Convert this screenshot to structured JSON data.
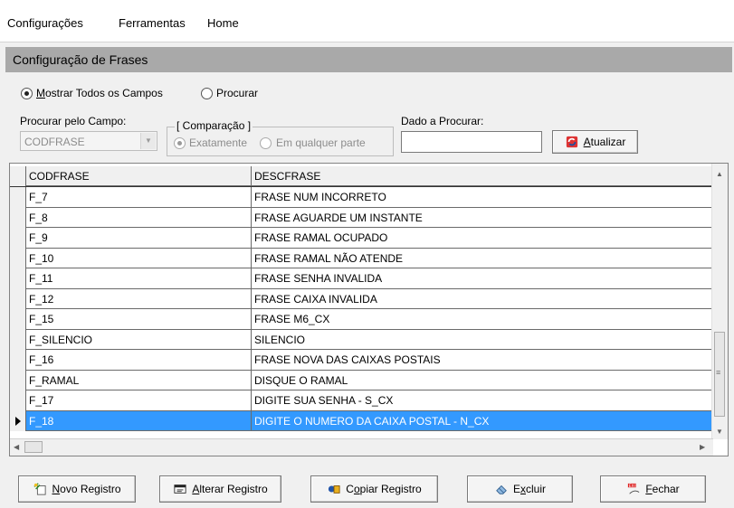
{
  "menu": {
    "items": [
      "Configurações",
      "Ferramentas",
      "Home"
    ]
  },
  "form_title": "Configuração de Frases",
  "mode": {
    "show_all_label": "Mostrar Todos os Campos",
    "show_all_mnemonic": "M",
    "search_label": "Procurar",
    "selected": "show_all"
  },
  "search_field": {
    "label": "Procurar pelo Campo:",
    "value": "CODFRASE"
  },
  "comparison": {
    "legend": "[ Comparação ]",
    "exact_label": "Exatamente",
    "any_label": "Em qualquer parte",
    "selected": "exact"
  },
  "search_value": {
    "label": "Dado a Procurar:",
    "value": ""
  },
  "refresh_button": {
    "label": "Atualizar",
    "mnemonic": "A"
  },
  "grid": {
    "columns": [
      "CODFRASE",
      "DESCFRASE"
    ],
    "rows": [
      [
        "F_7",
        "FRASE NUM INCORRETO"
      ],
      [
        "F_8",
        "FRASE AGUARDE UM INSTANTE"
      ],
      [
        "F_9",
        "FRASE RAMAL OCUPADO"
      ],
      [
        "F_10",
        "FRASE RAMAL NÃO ATENDE"
      ],
      [
        "F_11",
        "FRASE SENHA INVALIDA"
      ],
      [
        "F_12",
        "FRASE CAIXA INVALIDA"
      ],
      [
        "F_15",
        "FRASE M6_CX"
      ],
      [
        "F_SILENCIO",
        "SILENCIO"
      ],
      [
        "F_16",
        "FRASE NOVA DAS CAIXAS POSTAIS"
      ],
      [
        "F_RAMAL",
        "DISQUE O RAMAL"
      ],
      [
        "F_17",
        "DIGITE SUA SENHA - S_CX"
      ],
      [
        "F_18",
        "DIGITE O NUMERO DA CAIXA POSTAL - N_CX"
      ]
    ],
    "selected_row": 11
  },
  "actions": {
    "new": {
      "label": "Novo Registro",
      "mnemonic": "N"
    },
    "edit": {
      "label": "Alterar Registro",
      "mnemonic": "A"
    },
    "copy": {
      "label": "Copiar Registro",
      "mnemonic": "o"
    },
    "delete": {
      "label": "Excluir",
      "mnemonic": "x"
    },
    "close": {
      "label": "Fechar",
      "mnemonic": "F"
    }
  },
  "icons": {
    "new": "new-record-icon",
    "edit": "edit-record-icon",
    "copy": "copy-record-icon",
    "delete": "eraser-icon",
    "close": "exit-icon",
    "refresh": "refresh-icon"
  },
  "colors": {
    "title_bar": "#a9a9a9",
    "selection": "#3399ff"
  }
}
